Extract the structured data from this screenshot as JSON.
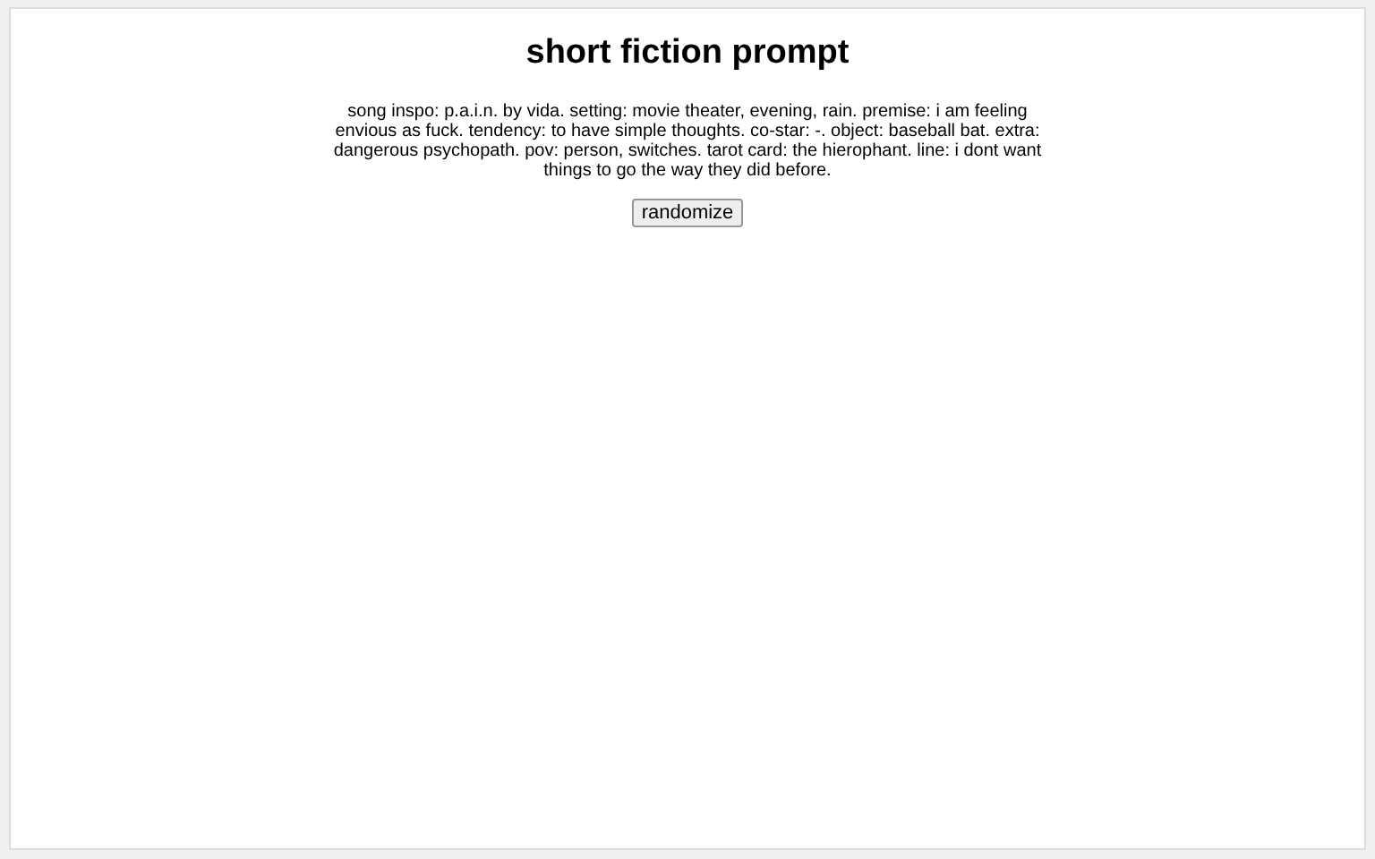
{
  "title": "short fiction prompt",
  "prompt": "song inspo: p.a.i.n. by vida. setting: movie theater, evening, rain. premise: i am feeling envious as fuck. tendency: to have simple thoughts. co-star: -. object: baseball bat. extra: dangerous psychopath. pov: person, switches. tarot card: the hierophant. line: i dont want things to go the way they did before.",
  "button": "randomize"
}
